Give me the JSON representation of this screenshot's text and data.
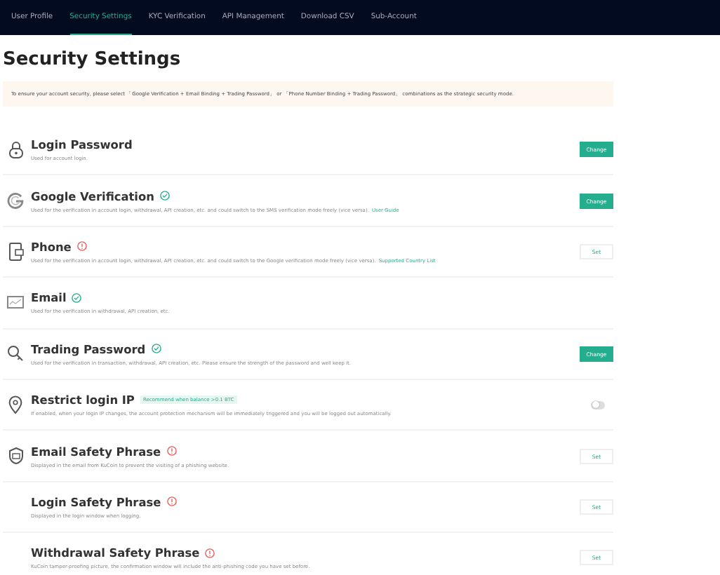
{
  "tabs": [
    {
      "label": "User Profile",
      "selected": false
    },
    {
      "label": "Security Settings",
      "selected": true
    },
    {
      "label": "KYC Verification",
      "selected": false
    },
    {
      "label": "API Management",
      "selected": false
    },
    {
      "label": "Download CSV",
      "selected": false
    },
    {
      "label": "Sub-Account",
      "selected": false
    }
  ],
  "page_title": "Security Settings",
  "notice": "To ensure your account security, please select 「Google Verification + Email Binding + Trading Password」 or 「Phone Number Binding + Trading Password」 combinations as the strategic security mode.",
  "settings": [
    {
      "title": "Login Password",
      "description": "Used for account login.",
      "action": {
        "kind": "primary",
        "label": "Change"
      }
    },
    {
      "title": "Google Verification",
      "verified": true,
      "description": "Used for the verification in account login, withdrawal, API creation, etc. and could switch to the SMS verification mode freely (vice versa).",
      "link": "User Guide",
      "action": {
        "kind": "primary",
        "label": "Change"
      }
    },
    {
      "title": "Phone",
      "verified": false,
      "description": "Used for the verification in account login, withdrawal, API creation, etc. and could switch to the Google verification mode freely (vice versa).",
      "link": "Supported Country List",
      "action": {
        "kind": "plain",
        "label": "Set"
      }
    },
    {
      "title": "Email",
      "verified": true,
      "description": "Used for the verification in withdrawal, API creation, etc."
    },
    {
      "title": "Trading Password",
      "verified": true,
      "description": "Used for the verification in transaction, withdrawal, API creation, etc. Please ensure the strength of the password and well keep it.",
      "action": {
        "kind": "primary",
        "label": "Change"
      }
    },
    {
      "title": "Restrict login IP",
      "tag": "Recommend when balance >0.1 BTC",
      "description": "If enabled, when your login IP changes, the account protection mechanism will be immediately triggered and you will be logged out automatically.",
      "toggle": {
        "on": false
      }
    },
    {
      "title": "Email Safety Phrase",
      "verified": false,
      "description": "Displayed in the email from KuCoin to prevent the visiting of a phishing website.",
      "action": {
        "kind": "plain",
        "label": "Set"
      }
    },
    {
      "title": "Login Safety Phrase",
      "verified": false,
      "description": "Displayed in the login window when logging.",
      "action": {
        "kind": "plain",
        "label": "Set"
      }
    },
    {
      "title": "Withdrawal Safety Phrase",
      "verified": false,
      "description": "KuCoin tamper-proofing picture, the confirmation window will include the anti-phishing code you have set before.",
      "action": {
        "kind": "plain",
        "label": "Set"
      }
    }
  ]
}
